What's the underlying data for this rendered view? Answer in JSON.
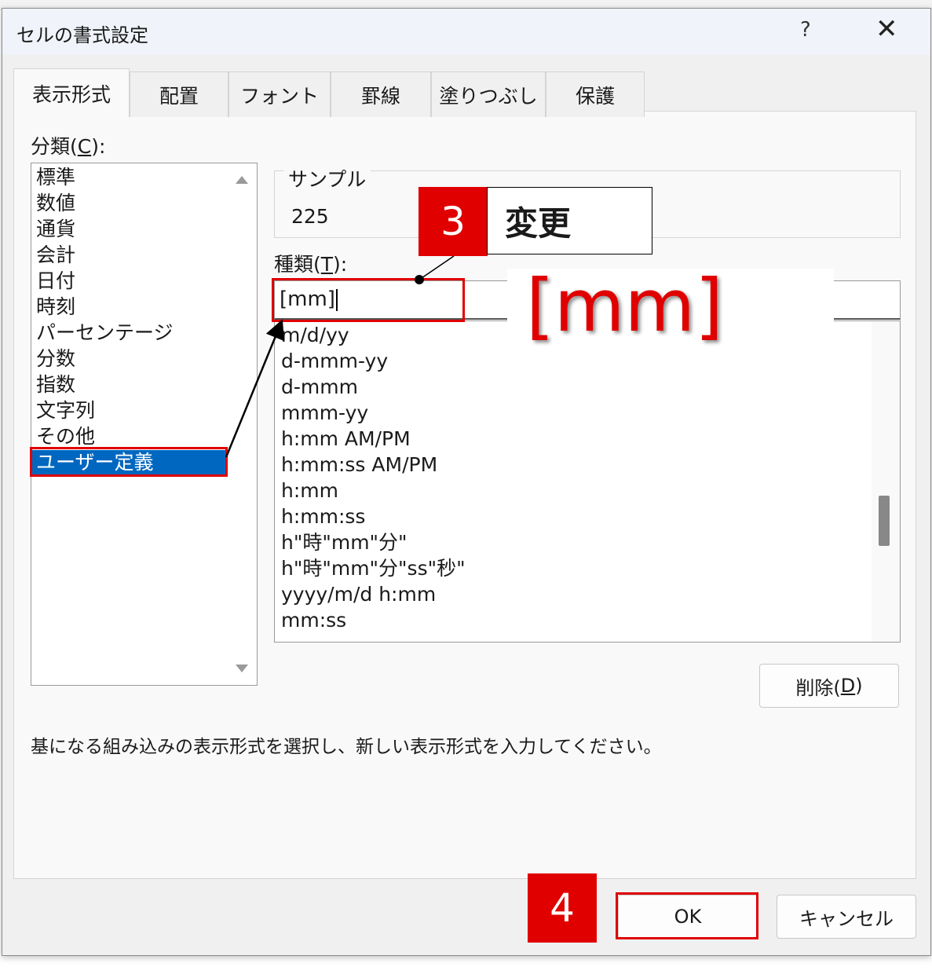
{
  "dialog": {
    "title": "セルの書式設定",
    "help": "?",
    "close": "✕"
  },
  "tabs": [
    "表示形式",
    "配置",
    "フォント",
    "罫線",
    "塗りつぶし",
    "保護"
  ],
  "category": {
    "label_prefix": "分類(",
    "label_key": "C",
    "label_suffix": "):",
    "items": [
      "標準",
      "数値",
      "通貨",
      "会計",
      "日付",
      "時刻",
      "パーセンテージ",
      "分数",
      "指数",
      "文字列",
      "その他",
      "ユーザー定義"
    ],
    "selected": "ユーザー定義"
  },
  "sample": {
    "legend": "サンプル",
    "value": "225"
  },
  "type": {
    "label_prefix": "種類(",
    "label_key": "T",
    "label_suffix": "):",
    "value": "[mm]",
    "formats": [
      "m/d/yy",
      "d-mmm-yy",
      "d-mmm",
      "mmm-yy",
      "h:mm AM/PM",
      "h:mm:ss AM/PM",
      "h:mm",
      "h:mm:ss",
      "h\"時\"mm\"分\"",
      "h\"時\"mm\"分\"ss\"秒\"",
      "yyyy/m/d h:mm",
      "mm:ss"
    ]
  },
  "delete_button": {
    "prefix": "削除(",
    "key": "D",
    "suffix": ")"
  },
  "description": "基になる組み込みの表示形式を選択し、新しい表示形式を入力してください。",
  "buttons": {
    "ok": "OK",
    "cancel": "キャンセル"
  },
  "annotations": {
    "step3_number": "3",
    "step3_label": "変更",
    "big_text": "[mm]",
    "step4_number": "4",
    "accent_color": "#e00000"
  }
}
